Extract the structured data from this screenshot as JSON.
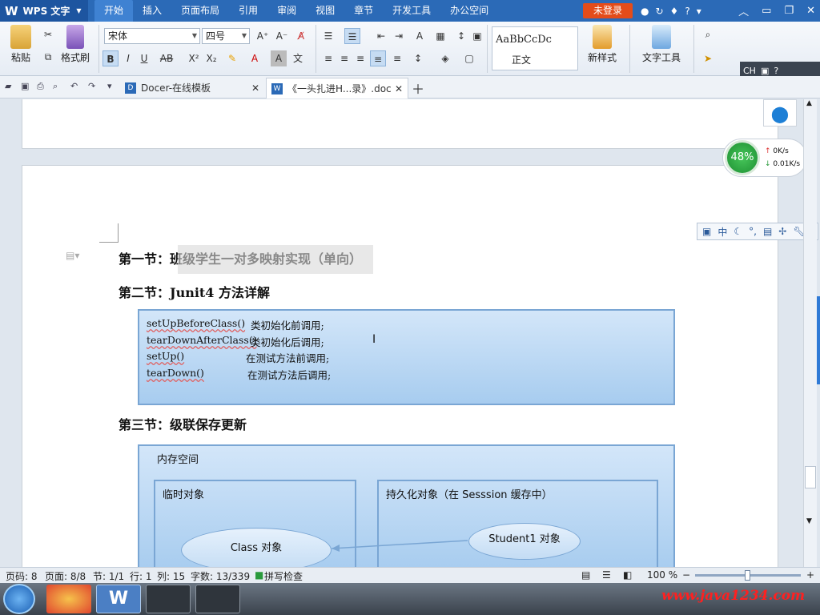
{
  "app": {
    "title": "WPS 文字",
    "login": "未登录"
  },
  "menu": {
    "tabs": [
      "开始",
      "插入",
      "页面布局",
      "引用",
      "审阅",
      "视图",
      "章节",
      "开发工具",
      "办公空间"
    ]
  },
  "ribbon": {
    "paste": "粘贴",
    "format_painter": "格式刷",
    "font_name": "宋体",
    "font_size": "四号",
    "style_preview": "AaBbCcDc",
    "style_name": "正文",
    "new_style": "新样式",
    "text_tools": "文字工具"
  },
  "tabs": [
    {
      "label": "Docer-在线模板"
    },
    {
      "label": "《一头扎进H...录》.doc"
    }
  ],
  "ime": {
    "label": "CH"
  },
  "speed": {
    "percent": "48%",
    "up": "0K/s",
    "down": "0.01K/s"
  },
  "doc": {
    "h1": "第一节：班级学生一对多映射实现（单向）",
    "h2": "第二节：Junit4 方法详解",
    "methods": [
      {
        "name": "setUpBeforeClass()",
        "desc": "类初始化前调用;"
      },
      {
        "name": "tearDownAfterClass()",
        "desc": "类初始化后调用;"
      },
      {
        "name": "setUp()",
        "desc": "在测试方法前调用;"
      },
      {
        "name": "tearDown()",
        "desc": "在测试方法后调用;"
      }
    ],
    "h3": "第三节：级联保存更新",
    "diagram": {
      "memory": "内存空间",
      "temp": "临时对象",
      "persist": "持久化对象（在 Sesssion 缓存中）",
      "class_obj": "Class 对象",
      "student_obj": "Student1 对象"
    }
  },
  "status": {
    "page": "页码: 8",
    "pages": "页面: 8/8",
    "section": "节: 1/1",
    "row": "行: 1",
    "col": "列: 15",
    "words": "字数: 13/339",
    "spell": "拼写检查",
    "zoom": "100 %"
  },
  "watermark": "www.java1234.com"
}
